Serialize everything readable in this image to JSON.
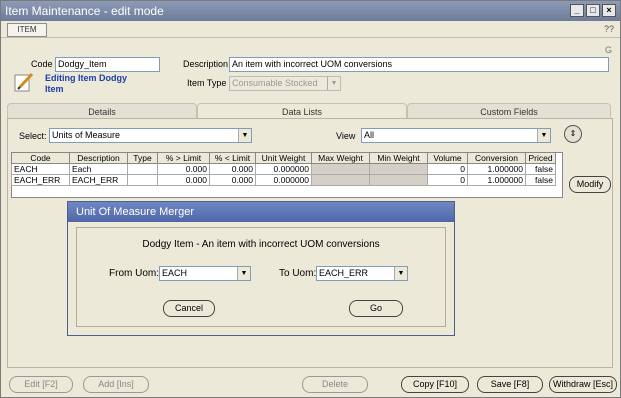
{
  "window": {
    "title": "Item Maintenance - edit mode",
    "help": "??"
  },
  "menu": {
    "item": "ITEM"
  },
  "corner_mark": "G",
  "form": {
    "code_label": "Code",
    "code_value": "Dodgy_Item",
    "description_label": "Description",
    "description_value": "An item with incorrect UOM conversions",
    "item_type_label": "Item Type",
    "item_type_value": "Consumable Stocked",
    "editing_text": "Editing Item Dodgy Item"
  },
  "tabs": [
    {
      "label": "Details"
    },
    {
      "label": "Data Lists"
    },
    {
      "label": "Custom Fields"
    }
  ],
  "list": {
    "select_label": "Select:",
    "select_value": "Units of Measure",
    "view_label": "View",
    "view_value": "All"
  },
  "table": {
    "headers": [
      "Code",
      "Description",
      "Type",
      "% > Limit",
      "% < Limit",
      "Unit Weight",
      "Max Weight",
      "Min Weight",
      "Volume",
      "Conversion",
      "Priced"
    ],
    "rows": [
      [
        "EACH",
        "Each",
        "",
        "0.000",
        "0.000",
        "0.000000",
        "",
        "",
        "0",
        "1.000000",
        "false"
      ],
      [
        "EACH_ERR",
        "EACH_ERR",
        "",
        "0.000",
        "0.000",
        "0.000000",
        "",
        "",
        "0",
        "1.000000",
        "false"
      ]
    ]
  },
  "buttons": {
    "modify": "Modify",
    "edit": "Edit [F2]",
    "add": "Add [Ins]",
    "delete": "Delete",
    "copy": "Copy [F10]",
    "save": "Save [F8]",
    "withdraw": "Withdraw [Esc]",
    "circle": "⇕"
  },
  "dialog": {
    "title": "Unit Of Measure Merger",
    "summary": "Dodgy Item - An item with incorrect UOM conversions",
    "from_label": "From Uom:",
    "from_value": "EACH",
    "to_label": "To Uom:",
    "to_value": "EACH_ERR",
    "cancel": "Cancel",
    "go": "Go"
  }
}
